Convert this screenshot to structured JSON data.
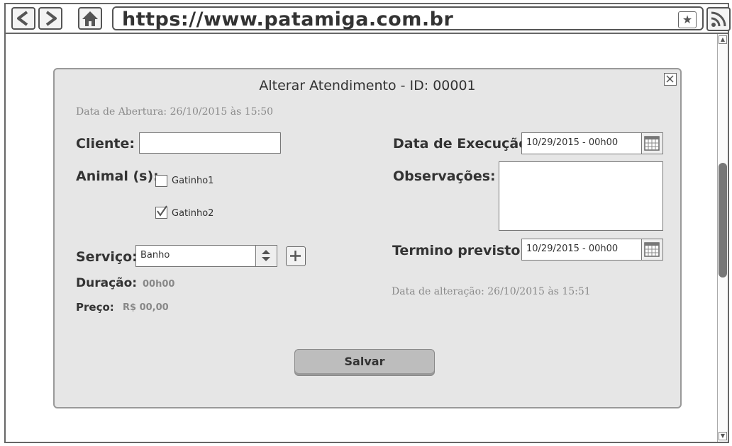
{
  "browser": {
    "url": "https://www.patamiga.com.br",
    "icons": {
      "back": "chevron-left-icon",
      "forward": "chevron-right-icon",
      "home": "home-icon",
      "bookmark": "star-icon",
      "feed": "rss-icon"
    }
  },
  "dialog": {
    "title": "Alterar Atendimento - ID: 00001",
    "opened_at": "Data de Abertura: 26/10/2015 às 15:50",
    "client_label": "Cliente:",
    "client_value": "",
    "animals_label": "Animal (s):",
    "animals": [
      {
        "name": "Gatinho1",
        "checked": false
      },
      {
        "name": "Gatinho2",
        "checked": true
      }
    ],
    "service_label": "Serviço:",
    "service_value": "Banho",
    "duration_label": "Duração:",
    "duration_value": "00h00",
    "price_label": "Preço:",
    "price_value": "R$ 00,00",
    "execution_label": "Data de Execução:",
    "execution_value": "10/29/2015 - 00h00",
    "notes_label": "Observações:",
    "notes_value": "",
    "end_label": "Termino previsto:",
    "end_value": "10/29/2015 - 00h00",
    "changed_at": "Data de alteração: 26/10/2015 às 15:51",
    "save_label": "Salvar"
  },
  "colors": {
    "dialog_bg": "#e6e6e6",
    "button_bg": "#bdbdbd",
    "muted_text": "#8a8a8a"
  }
}
